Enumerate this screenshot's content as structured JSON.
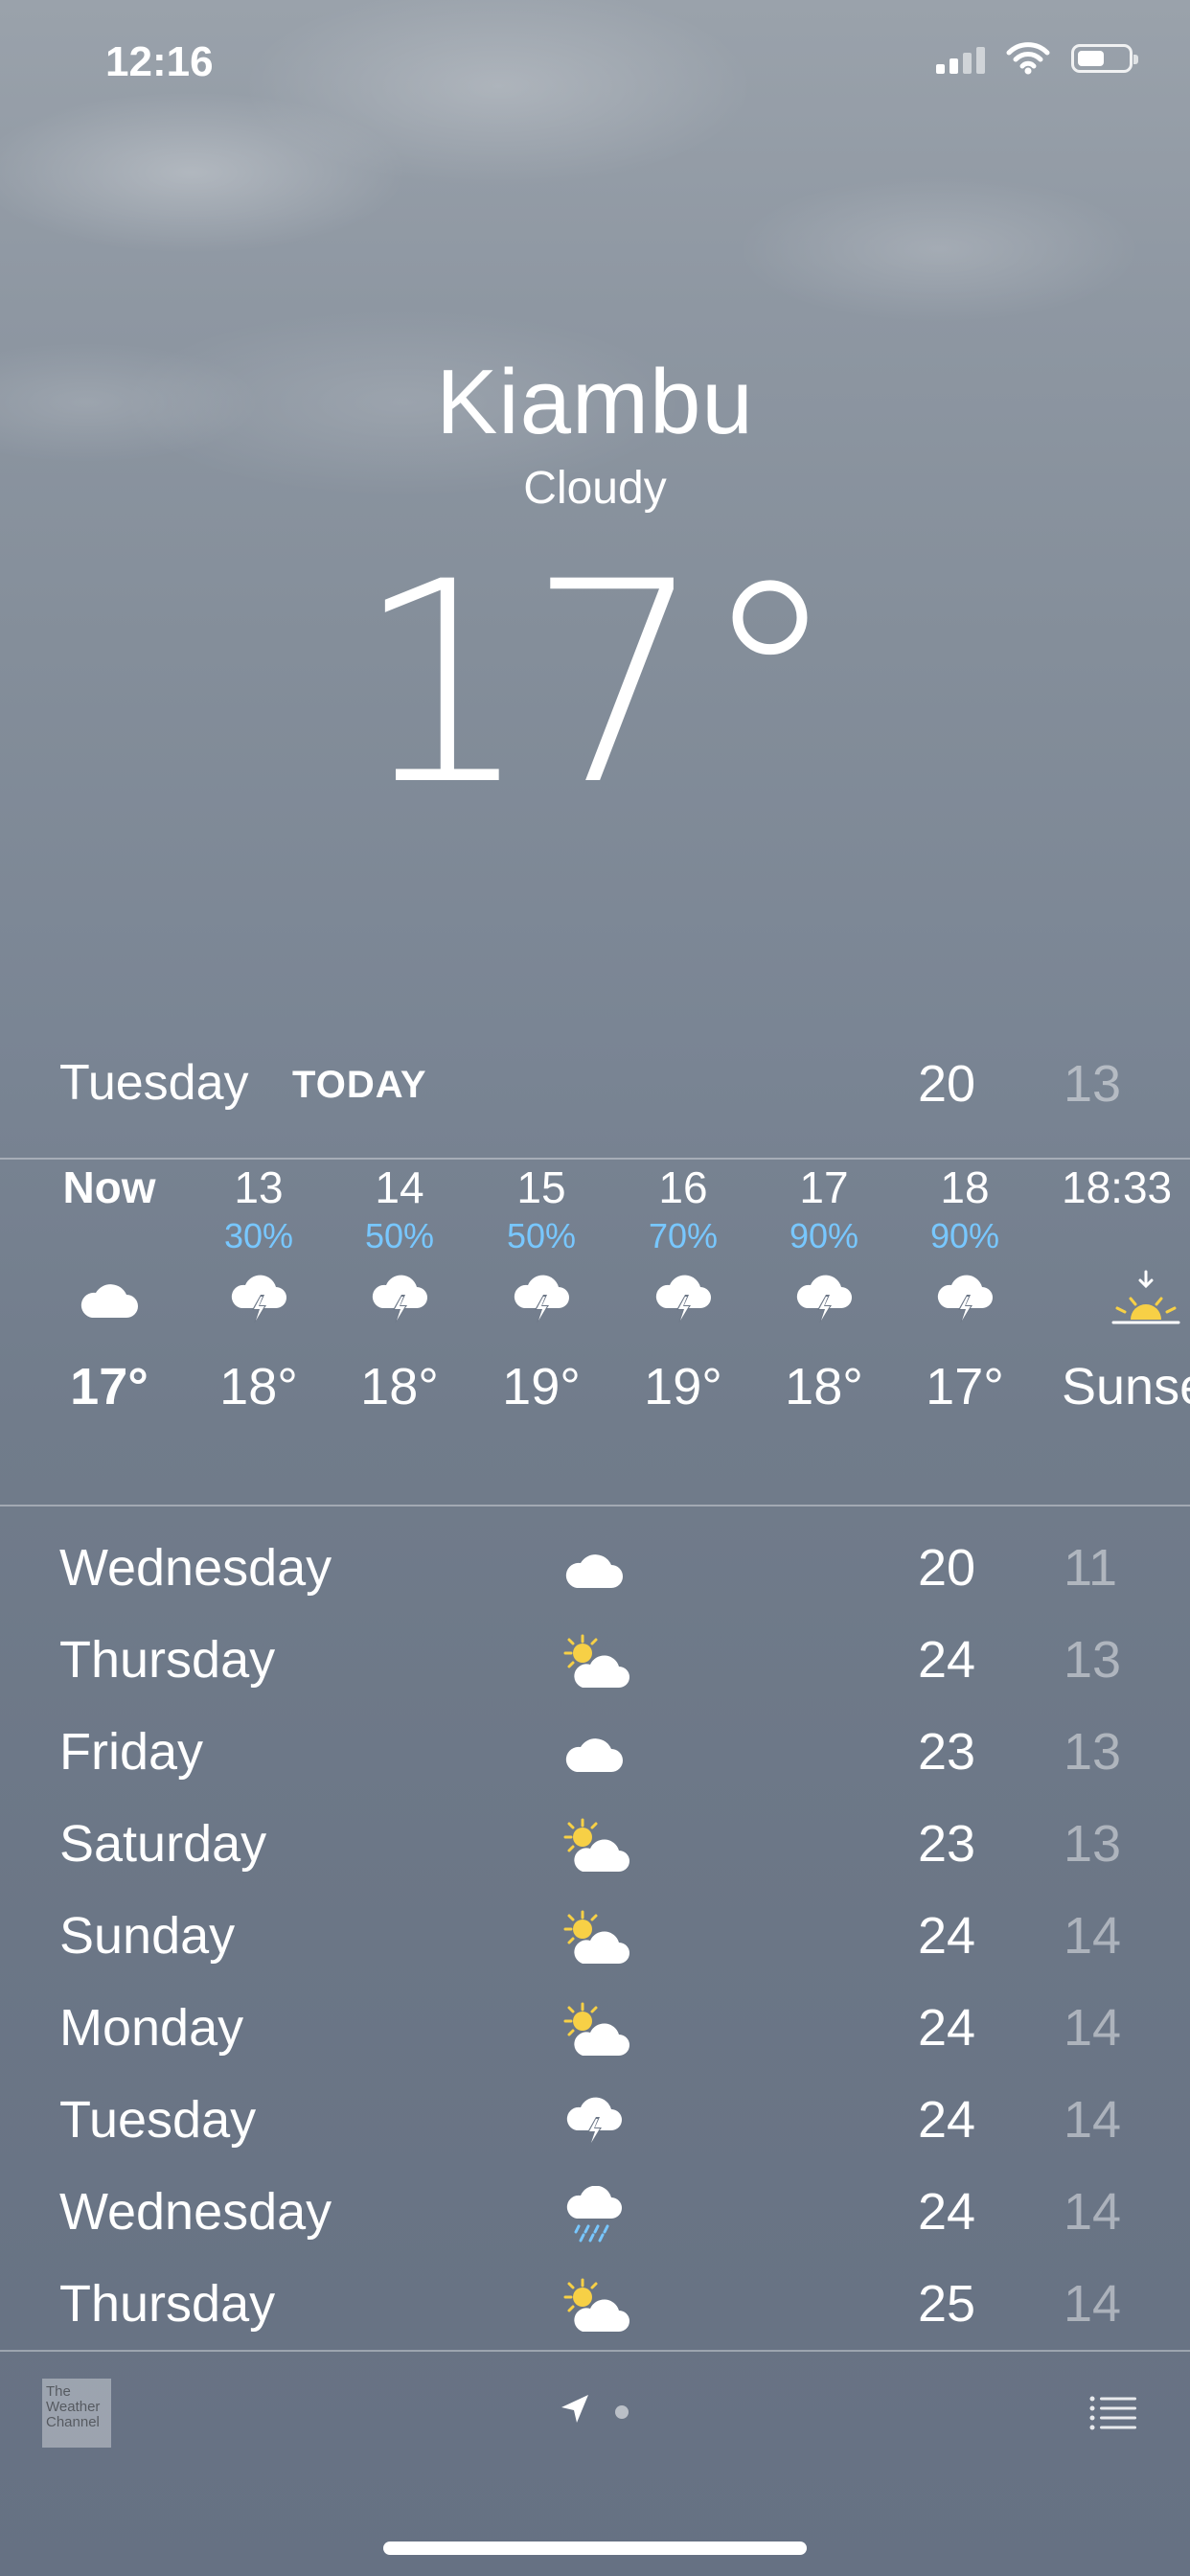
{
  "status_bar": {
    "time": "12:16"
  },
  "location": {
    "city": "Kiambu",
    "condition": "Cloudy",
    "temperature": "17°"
  },
  "today": {
    "day": "Tuesday",
    "label": "TODAY",
    "high": "20",
    "low": "13"
  },
  "hourly": [
    {
      "time": "Now",
      "pop": "",
      "icon": "cloud-icon",
      "temp": "17°"
    },
    {
      "time": "13",
      "pop": "30%",
      "icon": "thunderstorm-icon",
      "temp": "18°"
    },
    {
      "time": "14",
      "pop": "50%",
      "icon": "thunderstorm-icon",
      "temp": "18°"
    },
    {
      "time": "15",
      "pop": "50%",
      "icon": "thunderstorm-icon",
      "temp": "19°"
    },
    {
      "time": "16",
      "pop": "70%",
      "icon": "thunderstorm-icon",
      "temp": "19°"
    },
    {
      "time": "17",
      "pop": "90%",
      "icon": "thunderstorm-icon",
      "temp": "18°"
    },
    {
      "time": "18",
      "pop": "90%",
      "icon": "thunderstorm-icon",
      "temp": "17°"
    },
    {
      "time": "18:33",
      "pop": "",
      "icon": "sunset-icon",
      "temp": "Sunset"
    }
  ],
  "daily": [
    {
      "day": "Wednesday",
      "icon": "cloud-icon",
      "high": "20",
      "low": "11"
    },
    {
      "day": "Thursday",
      "icon": "partly-sunny-icon",
      "high": "24",
      "low": "13"
    },
    {
      "day": "Friday",
      "icon": "cloud-icon",
      "high": "23",
      "low": "13"
    },
    {
      "day": "Saturday",
      "icon": "partly-sunny-icon",
      "high": "23",
      "low": "13"
    },
    {
      "day": "Sunday",
      "icon": "partly-sunny-icon",
      "high": "24",
      "low": "14"
    },
    {
      "day": "Monday",
      "icon": "partly-sunny-icon",
      "high": "24",
      "low": "14"
    },
    {
      "day": "Tuesday",
      "icon": "thunderstorm-icon",
      "high": "24",
      "low": "14"
    },
    {
      "day": "Wednesday",
      "icon": "rain-icon",
      "high": "24",
      "low": "14"
    },
    {
      "day": "Thursday",
      "icon": "partly-sunny-icon",
      "high": "25",
      "low": "14"
    }
  ],
  "footer": {
    "weather_channel_logo": "The Weather Channel"
  },
  "colors": {
    "precip": "#78c7ff",
    "sun": "#f7d046"
  }
}
